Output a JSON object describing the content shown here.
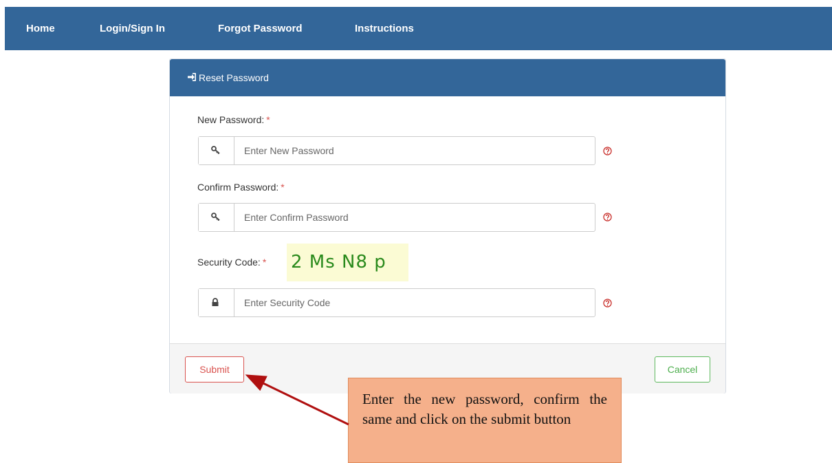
{
  "nav": {
    "items": [
      {
        "label": "Home"
      },
      {
        "label": "Login/Sign In"
      },
      {
        "label": "Forgot Password"
      },
      {
        "label": "Instructions"
      }
    ],
    "bg_color": "#336699"
  },
  "panel": {
    "title": "Reset Password",
    "title_icon": "sign-in-icon"
  },
  "form": {
    "new_password": {
      "label": "New Password:",
      "required_mark": "*",
      "placeholder": "Enter New Password",
      "icon": "key-icon"
    },
    "confirm_password": {
      "label": "Confirm Password:",
      "required_mark": "*",
      "placeholder": "Enter Confirm Password",
      "icon": "key-icon"
    },
    "security_code": {
      "label": "Security Code:",
      "required_mark": "*",
      "captcha": "2 Ms N8 p",
      "placeholder": "Enter Security Code",
      "icon": "lock-icon"
    },
    "help_icon": "question-circle-icon"
  },
  "footer": {
    "submit_label": "Submit",
    "cancel_label": "Cancel"
  },
  "callout": {
    "text": "Enter the new password, confirm the same and click on the submit button",
    "bg_color": "#f5b08b",
    "arrow_color": "#b01010"
  }
}
